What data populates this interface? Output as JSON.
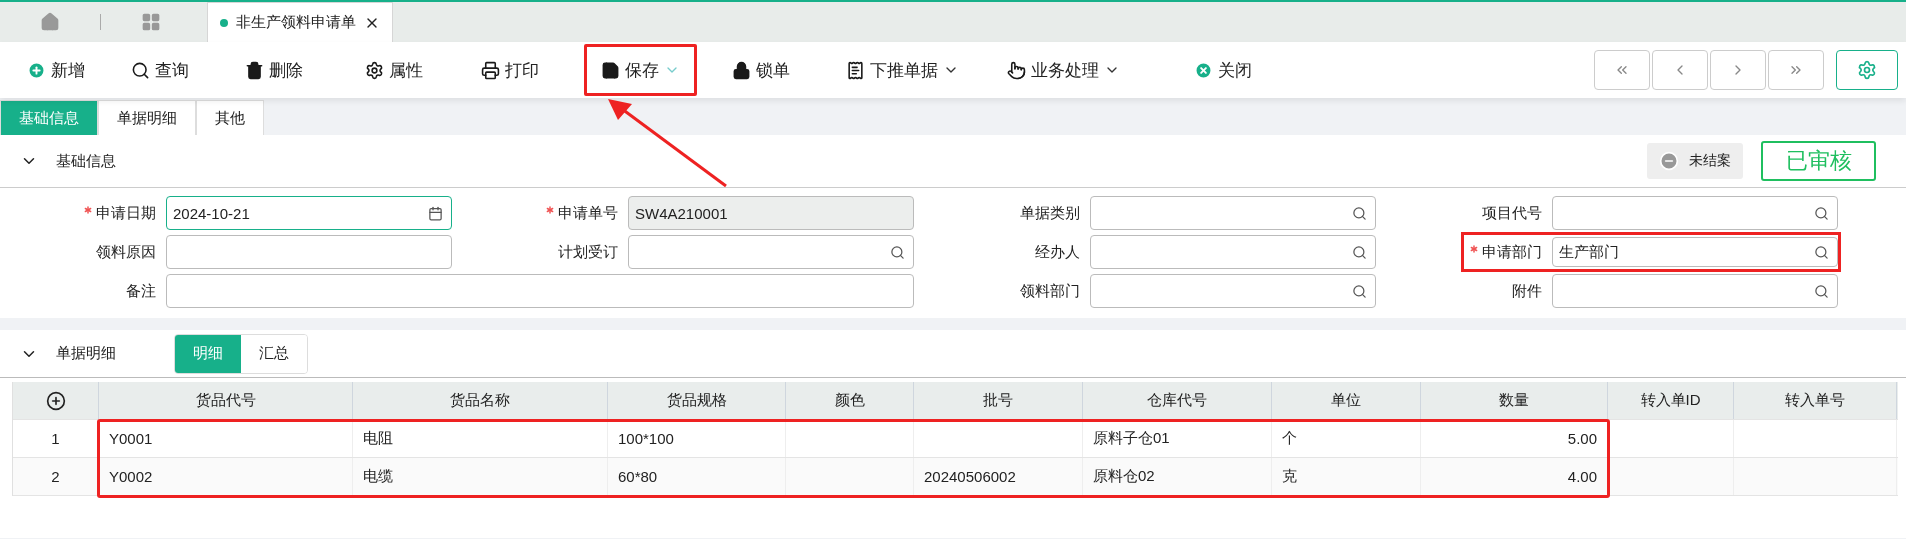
{
  "tabs": [
    {
      "label": "非生产领料申请单",
      "selected": true
    }
  ],
  "toolbar": [
    {
      "label": "新增",
      "dropdown": false,
      "highlighted": false
    },
    {
      "label": "查询",
      "dropdown": false,
      "highlighted": false
    },
    {
      "label": "删除",
      "dropdown": false,
      "highlighted": false
    },
    {
      "label": "属性",
      "dropdown": false,
      "highlighted": false
    },
    {
      "label": "打印",
      "dropdown": false,
      "highlighted": false
    },
    {
      "label": "保存",
      "dropdown": true,
      "highlighted": true
    },
    {
      "label": "锁单",
      "dropdown": false,
      "highlighted": false
    },
    {
      "label": "下推单据",
      "dropdown": true,
      "highlighted": false
    },
    {
      "label": "业务处理",
      "dropdown": true,
      "highlighted": false
    },
    {
      "label": "关闭",
      "dropdown": false,
      "highlighted": false
    }
  ],
  "form_tabs": [
    {
      "label": "基础信息",
      "selected": true
    },
    {
      "label": "单据明细",
      "selected": false
    },
    {
      "label": "其他",
      "selected": false
    }
  ],
  "basic_section": {
    "title": "基础信息",
    "expanded": true,
    "status_chip": "未结案",
    "stamp": "已审核"
  },
  "fields": [
    {
      "label": "申请日期",
      "required": true,
      "value": "2024-10-21",
      "kind": "date",
      "highlighted": false,
      "wide": false
    },
    {
      "label": "申请单号",
      "required": true,
      "value": "SW4A210001",
      "kind": "readonly",
      "highlighted": false,
      "wide": false
    },
    {
      "label": "单据类别",
      "required": false,
      "kind": "lookup",
      "highlighted": false,
      "wide": false
    },
    {
      "label": "项目代号",
      "required": false,
      "kind": "lookup",
      "highlighted": false,
      "wide": false
    },
    {
      "label": "领料原因",
      "required": false,
      "kind": "text",
      "highlighted": false,
      "wide": false
    },
    {
      "label": "计划受订",
      "required": false,
      "kind": "lookup",
      "highlighted": false,
      "wide": false
    },
    {
      "label": "经办人",
      "required": false,
      "kind": "lookup",
      "highlighted": false,
      "wide": false
    },
    {
      "label": "申请部门",
      "required": true,
      "value": "生产部门",
      "kind": "lookup",
      "highlighted": true,
      "wide": false
    },
    {
      "label": "备注",
      "required": false,
      "kind": "text",
      "highlighted": false,
      "wide": true
    },
    {
      "label": "领料部门",
      "required": false,
      "kind": "lookup",
      "highlighted": false,
      "wide": false
    },
    {
      "label": "附件",
      "required": false,
      "kind": "lookup",
      "highlighted": false,
      "wide": false
    }
  ],
  "detail_section": {
    "title": "单据明细",
    "expanded": true,
    "views": [
      {
        "label": "明细",
        "selected": true
      },
      {
        "label": "汇总",
        "selected": false
      }
    ]
  },
  "table": {
    "columns": [
      "货品代号",
      "货品名称",
      "货品规格",
      "颜色",
      "批号",
      "仓库代号",
      "单位",
      "数量",
      "转入单ID",
      "转入单号"
    ],
    "rows": [
      {
        "number": "1",
        "cells": [
          "Y0001",
          "电阻",
          "100*100",
          "",
          "",
          "原料子仓01",
          "个",
          "5.00",
          "",
          ""
        ],
        "highlighted": true
      },
      {
        "number": "2",
        "cells": [
          "Y0002",
          "电缆",
          "60*80",
          "",
          "20240506002",
          "原料仓02",
          "克",
          "4.00",
          "",
          ""
        ],
        "highlighted": true
      }
    ]
  }
}
